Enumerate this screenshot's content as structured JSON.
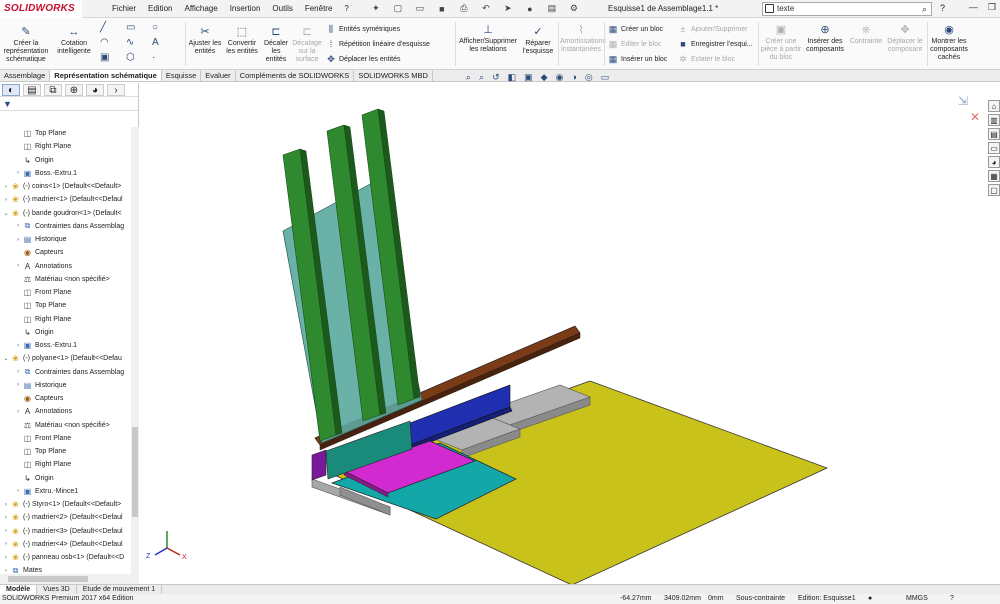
{
  "app": {
    "logo_text": "SOLIDWORKS",
    "document_title": "Esquisse1 de Assemblage1.1 *"
  },
  "menu": [
    "Fichier",
    "Edition",
    "Affichage",
    "Insertion",
    "Outils",
    "Fenêtre",
    "?"
  ],
  "search": {
    "value": "texte"
  },
  "ribbon": {
    "create_sketch": "Créer la représentation schématique",
    "dimension": "Cotation intelligente",
    "trim": "Ajuster les entités",
    "convert": "Convertir les entités",
    "offset": "Décaler les entités",
    "offset_surface": "Décalage sur la surface",
    "mirror": "Entités symétriques",
    "linear_pattern": "Répétition linéaire d'esquisse",
    "move": "Déplacer les entités",
    "show_relations": "Afficher/Supprimer les relations",
    "repair": "Réparer l'esquisse",
    "damping": "Amortissations instantanées",
    "make_block": "Créer un bloc",
    "edit_block": "Editer le bloc",
    "insert_block": "Insérer un bloc",
    "add_remove": "Ajouter/Supprimer",
    "save_block": "Enregistrer l'esqui...",
    "explode_block": "Eclater le bloc",
    "create_part": "Créer une pièce à partir du bloc",
    "insert_components": "Insérer des composants",
    "constraint": "Contrainte",
    "move_component": "Déplacer le composant",
    "show_hidden": "Montrer les composants cachés"
  },
  "tabs": [
    "Assemblage",
    "Représentation schématique",
    "Esquisse",
    "Evaluer",
    "Compléments de SOLIDWORKS",
    "SOLIDWORKS MBD"
  ],
  "active_tab": "Représentation schématique",
  "tree": [
    {
      "label": "Top Plane",
      "icon": "plane-icon",
      "indent": 2,
      "expand": ""
    },
    {
      "label": "Right Plane",
      "icon": "plane-icon",
      "indent": 2,
      "expand": ""
    },
    {
      "label": "Origin",
      "icon": "origin-icon",
      "indent": 2,
      "expand": ""
    },
    {
      "label": "Boss.-Extru.1",
      "icon": "feature-icon",
      "indent": 2,
      "expand": "›"
    },
    {
      "label": "(-) coins<1> (Default<<Default>",
      "icon": "part-icon",
      "indent": 1,
      "expand": "›"
    },
    {
      "label": "(-) madrier<1> (Default<<Defaul",
      "icon": "part-icon",
      "indent": 1,
      "expand": "›"
    },
    {
      "label": "(-) bande goudron<1> (Default<",
      "icon": "part-icon",
      "indent": 1,
      "expand": "⌄"
    },
    {
      "label": "Contraintes dans Assemblag",
      "icon": "mates-icon",
      "indent": 2,
      "expand": "›"
    },
    {
      "label": "Historique",
      "icon": "history-icon",
      "indent": 2,
      "expand": "›"
    },
    {
      "label": "Capteurs",
      "icon": "sensor-icon",
      "indent": 2,
      "expand": ""
    },
    {
      "label": "Annotations",
      "icon": "annotation-icon",
      "indent": 2,
      "expand": "›"
    },
    {
      "label": "Matériau <non spécifié>",
      "icon": "material-icon",
      "indent": 2,
      "expand": ""
    },
    {
      "label": "Front Plane",
      "icon": "plane-icon",
      "indent": 2,
      "expand": ""
    },
    {
      "label": "Top Plane",
      "icon": "plane-icon",
      "indent": 2,
      "expand": ""
    },
    {
      "label": "Right Plane",
      "icon": "plane-icon",
      "indent": 2,
      "expand": ""
    },
    {
      "label": "Origin",
      "icon": "origin-icon",
      "indent": 2,
      "expand": ""
    },
    {
      "label": "Boss.-Extru.1",
      "icon": "feature-icon",
      "indent": 2,
      "expand": "›"
    },
    {
      "label": "(-) polyane<1> (Default<<Defau",
      "icon": "part-icon",
      "indent": 1,
      "expand": "⌄"
    },
    {
      "label": "Contraintes dans Assemblag",
      "icon": "mates-icon",
      "indent": 2,
      "expand": "›"
    },
    {
      "label": "Historique",
      "icon": "history-icon",
      "indent": 2,
      "expand": "›"
    },
    {
      "label": "Capteurs",
      "icon": "sensor-icon",
      "indent": 2,
      "expand": ""
    },
    {
      "label": "Annotations",
      "icon": "annotation-icon",
      "indent": 2,
      "expand": "›"
    },
    {
      "label": "Matériau <non spécifié>",
      "icon": "material-icon",
      "indent": 2,
      "expand": ""
    },
    {
      "label": "Front Plane",
      "icon": "plane-icon",
      "indent": 2,
      "expand": ""
    },
    {
      "label": "Top Plane",
      "icon": "plane-icon",
      "indent": 2,
      "expand": ""
    },
    {
      "label": "Right Plane",
      "icon": "plane-icon",
      "indent": 2,
      "expand": ""
    },
    {
      "label": "Origin",
      "icon": "origin-icon",
      "indent": 2,
      "expand": ""
    },
    {
      "label": "Extru.-Mince1",
      "icon": "feature-icon",
      "indent": 2,
      "expand": "›"
    },
    {
      "label": "(-) Styro<1> (Default<<Default>",
      "icon": "part-icon",
      "indent": 1,
      "expand": "›"
    },
    {
      "label": "(-) madrier<2> (Default<<Defaul",
      "icon": "part-icon",
      "indent": 1,
      "expand": "›"
    },
    {
      "label": "(-) madrier<3> (Default<<Defaul",
      "icon": "part-icon",
      "indent": 1,
      "expand": "›"
    },
    {
      "label": "(-) madrier<4> (Default<<Defaul",
      "icon": "part-icon",
      "indent": 1,
      "expand": "›"
    },
    {
      "label": "(-) panneau osb<1> (Default<<D",
      "icon": "part-icon",
      "indent": 1,
      "expand": "›"
    },
    {
      "label": "Mates",
      "icon": "mates-icon",
      "indent": 1,
      "expand": "›"
    }
  ],
  "bottom_tabs": [
    "Modèle",
    "Vues 3D",
    "Etude de mouvement 1"
  ],
  "status": {
    "product": "SOLIDWORKS Premium 2017 x64 Edition",
    "x": "-64.27mm",
    "y": "3409.02mm",
    "z": "0mm",
    "state": "Sous-contrainte",
    "editing": "Edition: Esquisse1",
    "units": "MMGS"
  },
  "colors": {
    "green": "#2f8a2f",
    "teal_panel": "#5aa99f",
    "brown": "#7b3b16",
    "blue": "#1f2fb0",
    "yellow": "#c8c21a",
    "magenta": "#d02ad0",
    "cyan": "#14a7a7",
    "grey": "#a8a8a8"
  }
}
